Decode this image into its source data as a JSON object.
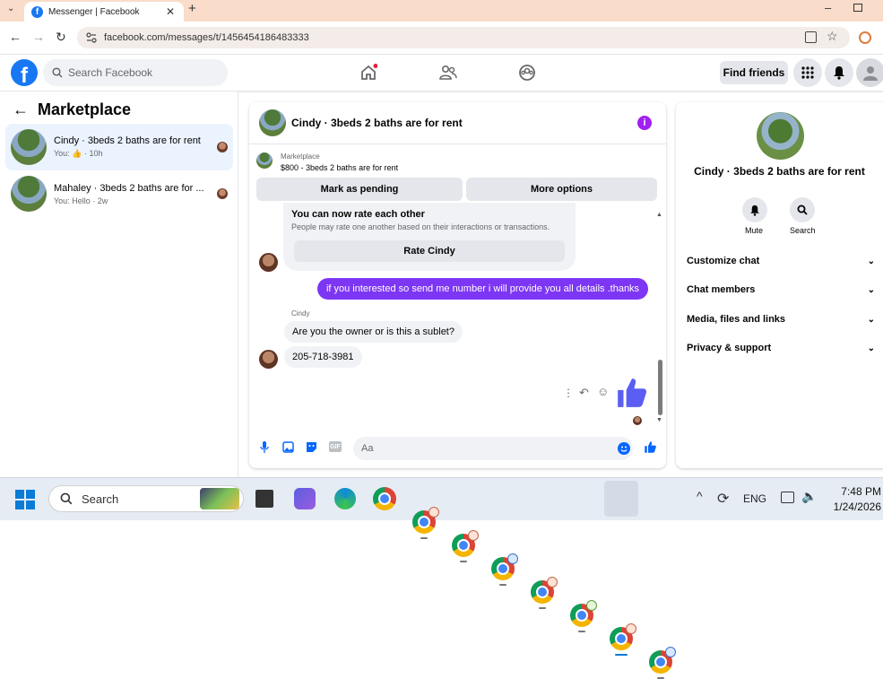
{
  "browser": {
    "tab_title": "Messenger | Facebook",
    "url": "facebook.com/messages/t/1456454186483333"
  },
  "header": {
    "search_placeholder": "Search Facebook",
    "find_friends": "Find friends"
  },
  "left": {
    "title": "Marketplace",
    "conversations": [
      {
        "name": "Cindy · 3beds 2 baths are for rent",
        "preview_prefix": "You:",
        "preview_suffix": "· 10h",
        "active": true
      },
      {
        "name": "Mahaley · 3beds 2 baths are for ...",
        "preview": "You: Hello · 2w",
        "active": false
      }
    ]
  },
  "chat": {
    "title": "Cindy · 3beds 2 baths are for rent",
    "listing_label": "Marketplace",
    "listing_price": "$800 - 3beds 2 baths are for rent",
    "mark_pending": "Mark as pending",
    "more_options": "More options",
    "rate_heading": "You can now rate each other",
    "rate_desc": "People may rate one another based on their interactions or transactions.",
    "rate_button": "Rate Cindy",
    "outgoing_message": "if you interested so send me number i will provide you all details .thanks",
    "sender_name": "Cindy",
    "incoming_messages": [
      "Are you the owner or is this a sublet?",
      "205-718-3981"
    ],
    "composer_placeholder": "Aa"
  },
  "right": {
    "name": "Cindy · 3beds 2 baths are for rent",
    "mute_label": "Mute",
    "search_label": "Search",
    "sections": [
      "Customize chat",
      "Chat members",
      "Media, files and links",
      "Privacy & support"
    ]
  },
  "taskbar": {
    "search_placeholder": "Search",
    "language": "ENG",
    "time": "7:48 PM",
    "date": "1/24/2026"
  },
  "colors": {
    "facebook_blue": "#1877f2",
    "message_purple": "#7d36f3",
    "like_blue": "#5b5ef2",
    "info_purple": "#a020f0"
  }
}
